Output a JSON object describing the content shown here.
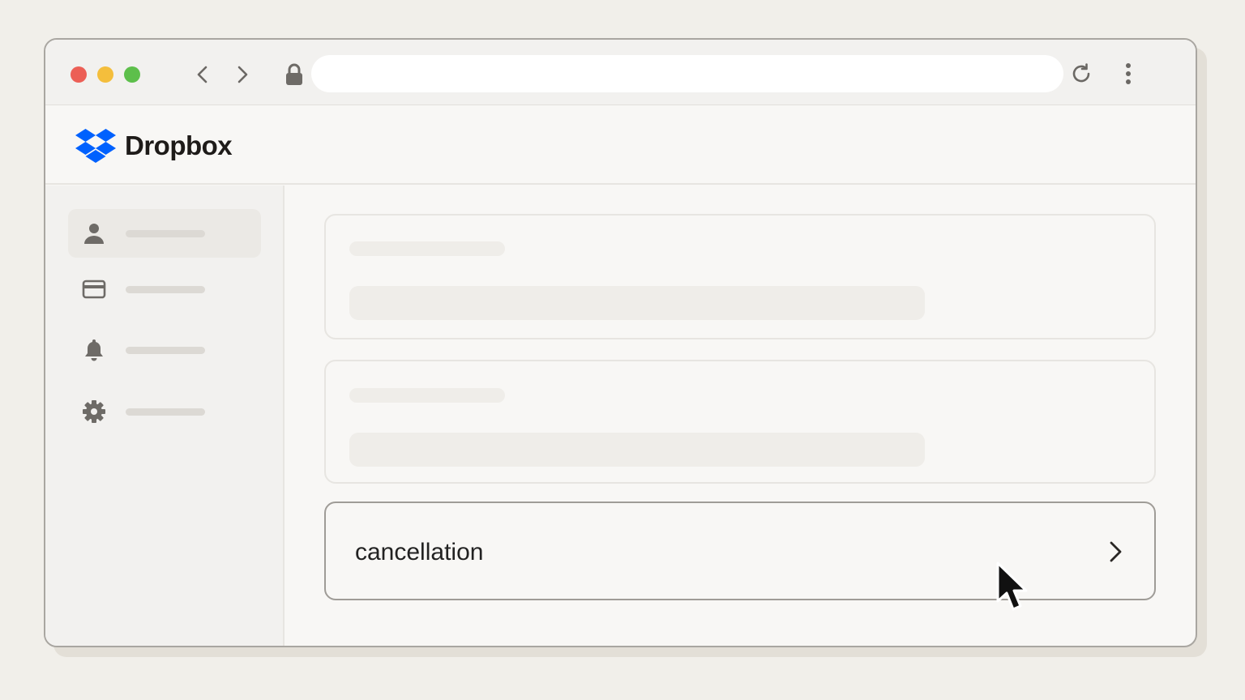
{
  "browser": {
    "window_controls": [
      "close",
      "minimize",
      "maximize"
    ],
    "nav": {
      "back_icon": "chevron-left-icon",
      "forward_icon": "chevron-right-icon"
    },
    "address_bar": {
      "icon": "lock-icon",
      "url": ""
    },
    "reload_icon": "reload-icon",
    "menu_icon": "kebab-menu-icon"
  },
  "app": {
    "brand": "Dropbox",
    "brand_color": "#0061fe"
  },
  "sidebar": {
    "items": [
      {
        "icon": "person-icon",
        "active": true
      },
      {
        "icon": "credit-card-icon",
        "active": false
      },
      {
        "icon": "bell-icon",
        "active": false
      },
      {
        "icon": "gear-icon",
        "active": false
      }
    ]
  },
  "main": {
    "cancel_row": {
      "label": "cancellation",
      "icon": "chevron-right-icon"
    }
  }
}
